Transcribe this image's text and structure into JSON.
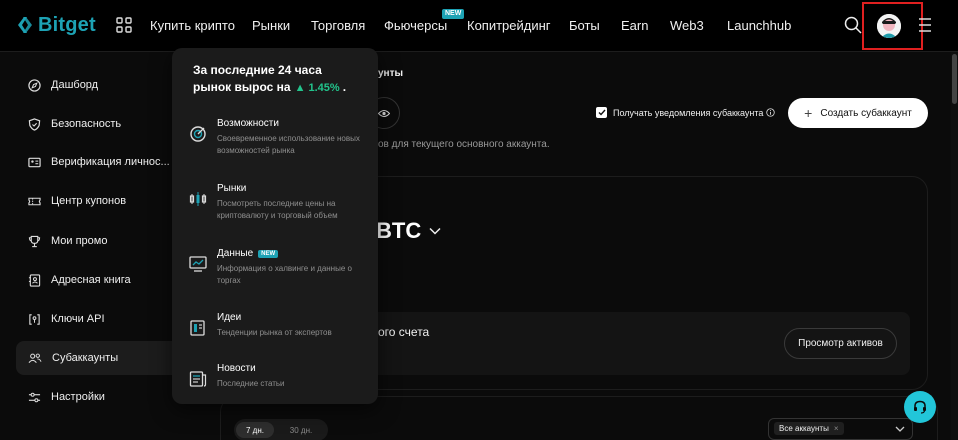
{
  "brand": {
    "name": "Bitget",
    "color": "#1da2b4"
  },
  "nav": {
    "items": [
      {
        "label": "Купить крипто"
      },
      {
        "label": "Рынки"
      },
      {
        "label": "Торговля"
      },
      {
        "label": "Фьючерсы",
        "badge": "NEW"
      },
      {
        "label": "Копитрейдинг"
      },
      {
        "label": "Боты"
      },
      {
        "label": "Earn"
      },
      {
        "label": "Web3"
      },
      {
        "label": "Launchhub"
      }
    ]
  },
  "sidebar": {
    "items": [
      {
        "label": "Дашборд",
        "icon": "compass-icon"
      },
      {
        "label": "Безопасность",
        "icon": "shield-icon"
      },
      {
        "label": "Верификация личнос...",
        "icon": "id-card-icon"
      },
      {
        "label": "Центр купонов",
        "icon": "ticket-icon"
      },
      {
        "label": "Мои промо",
        "icon": "trophy-icon"
      },
      {
        "label": "Адресная книга",
        "icon": "address-book-icon"
      },
      {
        "label": "Ключи API",
        "icon": "api-key-icon"
      },
      {
        "label": "Субаккаунты",
        "icon": "users-icon",
        "active": true
      },
      {
        "label": "Настройки",
        "icon": "sliders-icon"
      }
    ]
  },
  "main": {
    "breadcrumb": "унты",
    "description": "ов для текущего основного аккаунта.",
    "notify_label": "Получать уведомления субаккаунта",
    "create_button": "Создать субаккаунт",
    "currency": "BTC",
    "account_title": "ого счета",
    "view_assets_button": "Просмотр активов",
    "ranges": [
      "7 дн.",
      "30 дн."
    ],
    "filter_value": "Все аккаунты"
  },
  "dropdown": {
    "headline_line1": "За последние 24 часа",
    "headline_line2": "рынок вырос на",
    "change": "▲ 1.45%",
    "change_suffix": ".",
    "items": [
      {
        "title": "Возможности",
        "desc": "Своевременное использование новых возможностей рынка",
        "icon": "opportunity-icon"
      },
      {
        "title": "Рынки",
        "desc": "Посмотреть последние цены на криптовалюту и торговый объем",
        "icon": "candlestick-icon"
      },
      {
        "title": "Данные",
        "badge": "NEW",
        "desc": "Информация о халвинге и данные о торгах",
        "icon": "chart-screen-icon"
      },
      {
        "title": "Идеи",
        "desc": "Тенденции рынка от экспертов",
        "icon": "ideas-icon"
      },
      {
        "title": "Новости",
        "desc": "Последние статьи",
        "icon": "news-icon"
      }
    ]
  },
  "colors": {
    "accent": "#1da2b4",
    "up": "#22c48c",
    "highlight_box": "#e02020",
    "support": "#22c6d9"
  }
}
